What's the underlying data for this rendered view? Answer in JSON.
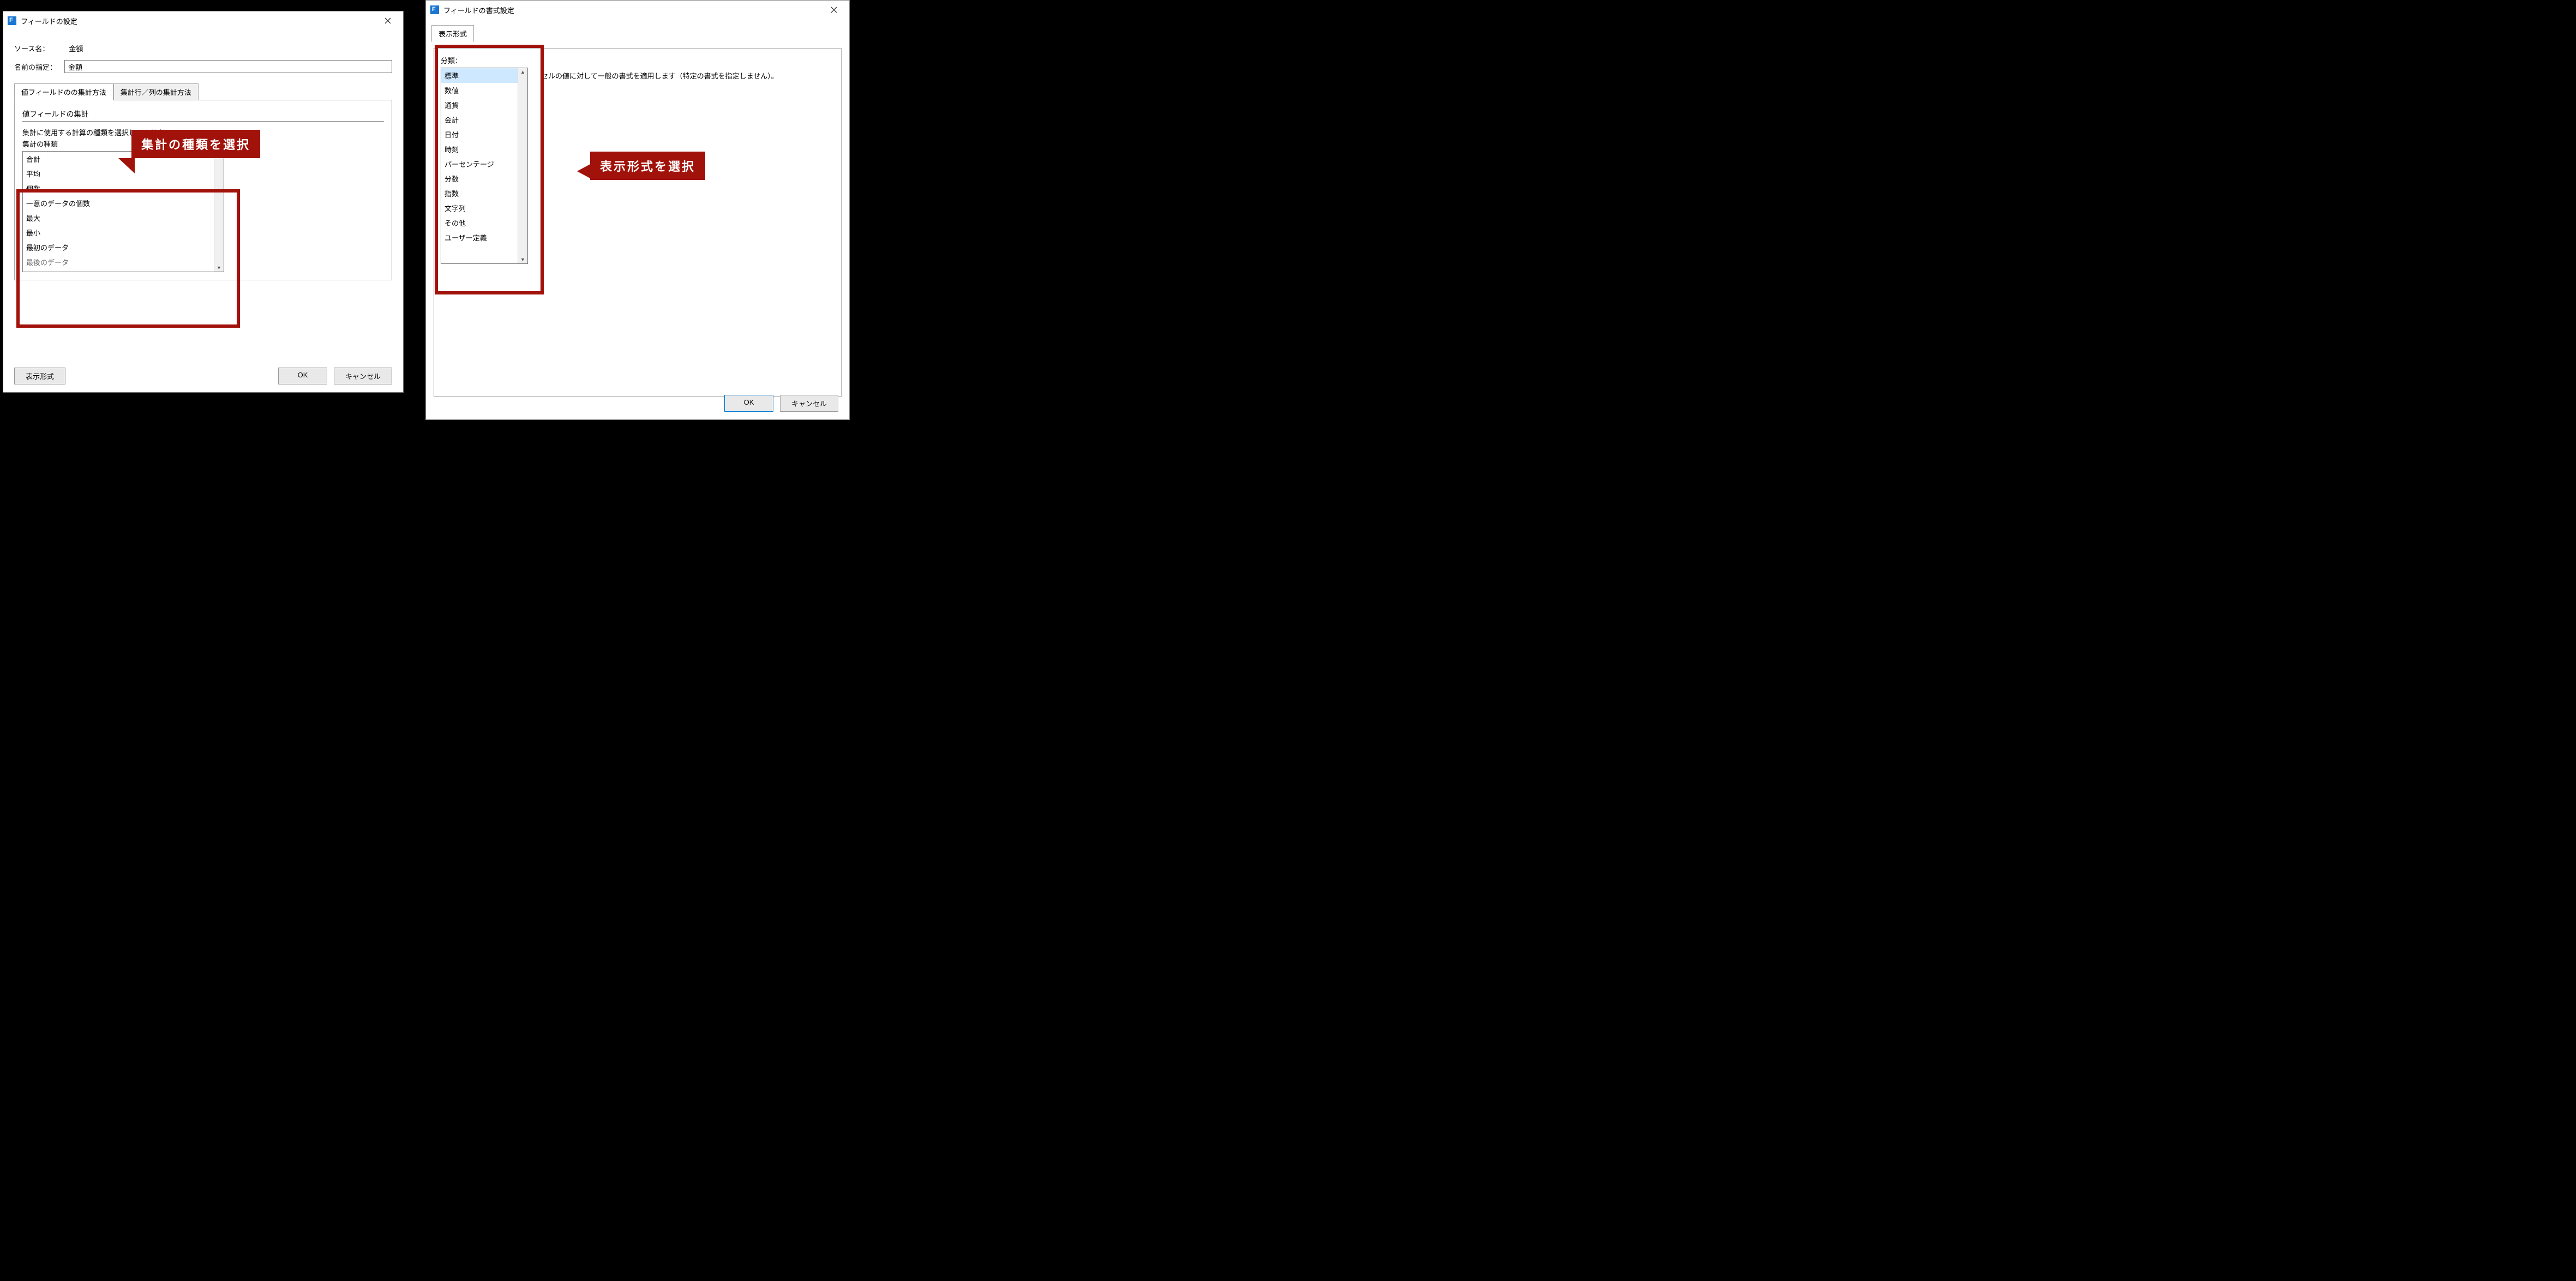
{
  "dialog_left": {
    "title": "フィールドの設定",
    "source_label": "ソース名：",
    "source_value": "金額",
    "name_label": "名前の指定：",
    "name_value": "金額",
    "tabs": [
      "値フィールドのの集計方法",
      "集計行／列の集計方法"
    ],
    "section_title": "値フィールドの集計",
    "hint1": "集計に使用する計算の種類を選択してください。",
    "hint2": "集計の種類",
    "agg_options": [
      "合計",
      "平均",
      "個数",
      "一意のデータの個数",
      "最大",
      "最小",
      "最初のデータ",
      "最後のデータ"
    ],
    "format_button": "表示形式",
    "ok": "OK",
    "cancel": "キャンセル"
  },
  "dialog_right": {
    "title": "フィールドの書式設定",
    "tab": "表示形式",
    "cat_label": "分類：",
    "categories": [
      "標準",
      "数値",
      "通貨",
      "会計",
      "日付",
      "時刻",
      "パーセンテージ",
      "分数",
      "指数",
      "文字列",
      "その他",
      "ユーザー定義"
    ],
    "selected_index": 0,
    "description": "セルの値に対して一般の書式を適用します（特定の書式を指定しません）。",
    "ok": "OK",
    "cancel": "キャンセル"
  },
  "callouts": {
    "left": "集計の種類を選択",
    "right": "表示形式を選択"
  }
}
